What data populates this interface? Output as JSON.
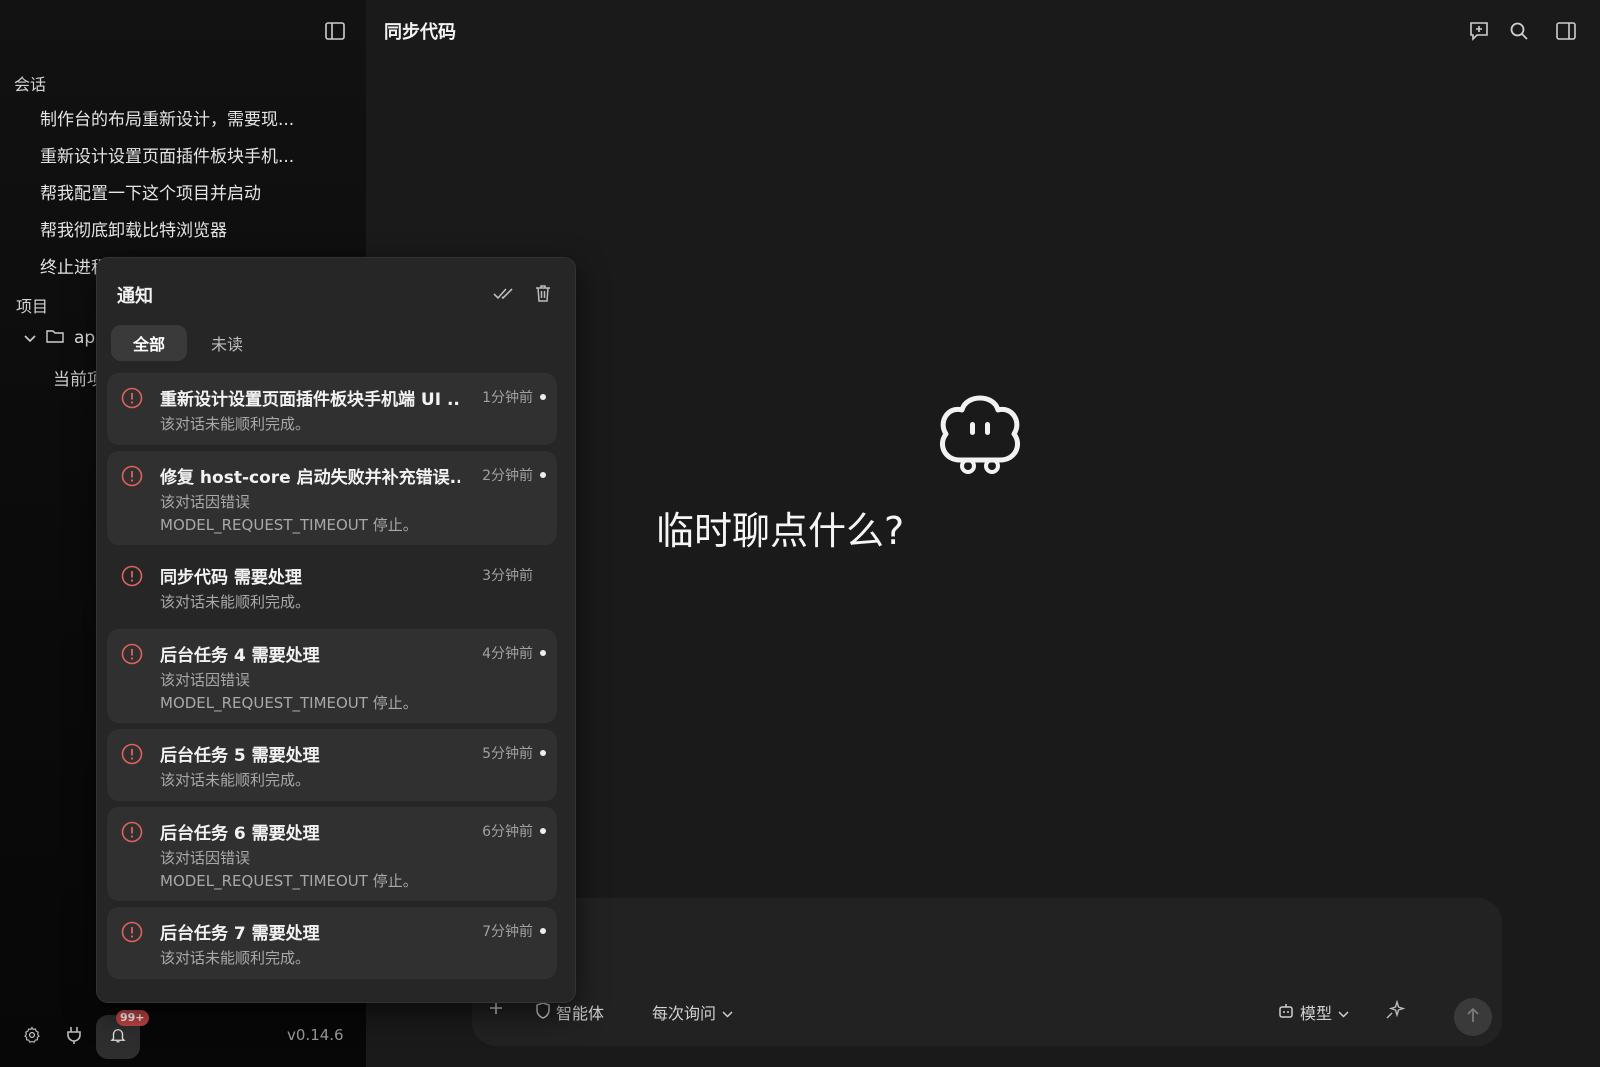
{
  "sidebar": {
    "conversations_title": "会话",
    "conversations": [
      "制作台的布局重新设计，需要现...",
      "重新设计设置页面插件板块手机...",
      "帮我配置一下这个项目并启动",
      "帮我彻底卸载比特浏览器",
      "终止进程"
    ],
    "projects_title": "项目",
    "project_name": "app",
    "project_sub": "当前项",
    "notification_badge": "99+",
    "version": "v0.14.6"
  },
  "main": {
    "title": "同步代码",
    "hero_text": "临时聊点什么?",
    "composer": {
      "agent_label": "智能体",
      "ask_label": "每次询问",
      "model_label": "模型"
    }
  },
  "notifications": {
    "title": "通知",
    "tabs": [
      "全部",
      "未读"
    ],
    "items": [
      {
        "title": "重新设计设置页面插件板块手机端 UI ...",
        "body": "该对话未能顺利完成。",
        "time": "1分钟前",
        "unread": true,
        "lines": 1
      },
      {
        "title": "修复 host-core 启动失败并补充错误...",
        "body": "该对话因错误 MODEL_REQUEST_TIMEOUT 停止。",
        "time": "2分钟前",
        "unread": true,
        "lines": 2
      },
      {
        "title": "同步代码 需要处理",
        "body": "该对话未能顺利完成。",
        "time": "3分钟前",
        "unread": false,
        "lines": 1
      },
      {
        "title": "后台任务 4 需要处理",
        "body": "该对话因错误 MODEL_REQUEST_TIMEOUT 停止。",
        "time": "4分钟前",
        "unread": true,
        "lines": 2
      },
      {
        "title": "后台任务 5 需要处理",
        "body": "该对话未能顺利完成。",
        "time": "5分钟前",
        "unread": true,
        "lines": 1
      },
      {
        "title": "后台任务 6 需要处理",
        "body": "该对话因错误 MODEL_REQUEST_TIMEOUT 停止。",
        "time": "6分钟前",
        "unread": true,
        "lines": 2
      },
      {
        "title": "后台任务 7 需要处理",
        "body": "该对话未能顺利完成。",
        "time": "7分钟前",
        "unread": true,
        "lines": 1
      }
    ]
  },
  "colors": {
    "alert": "#e0625c",
    "badge": "#c04444"
  }
}
